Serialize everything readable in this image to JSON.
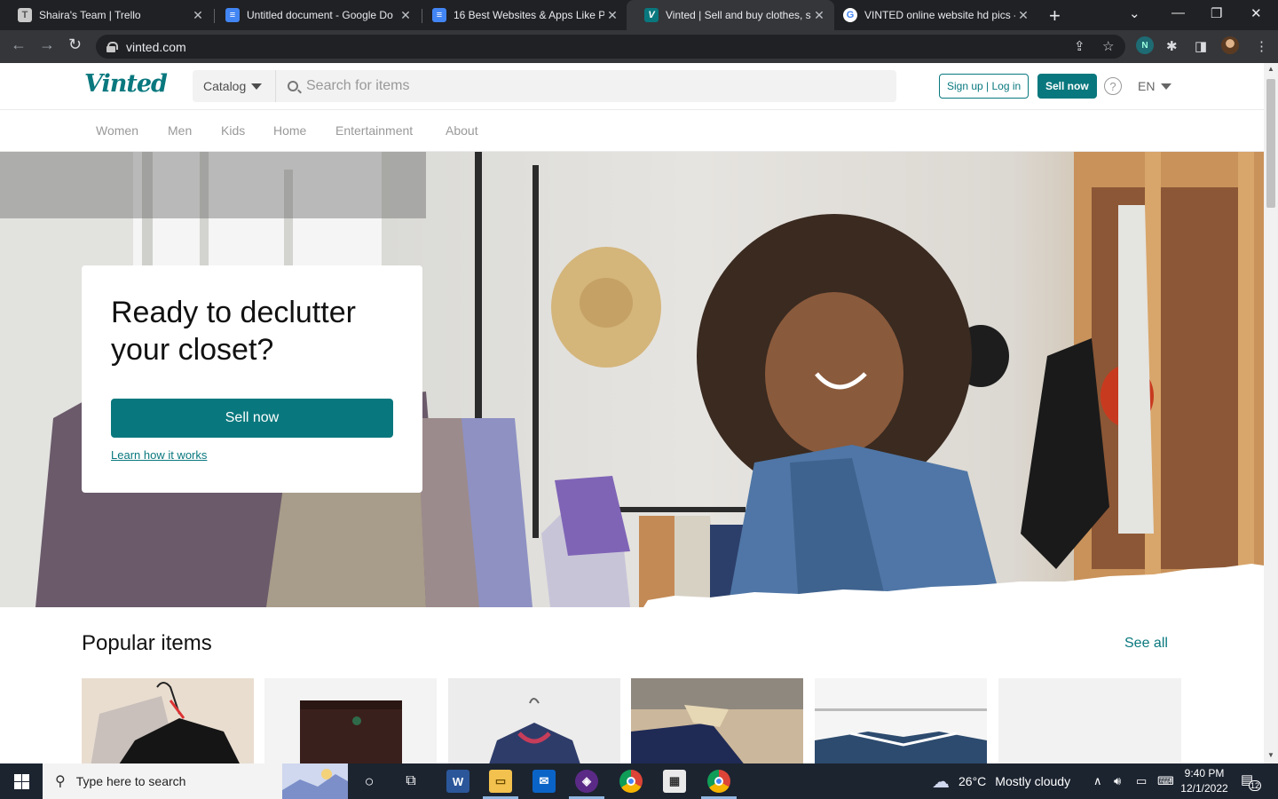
{
  "browser": {
    "tabs": [
      {
        "title": "Shaira's Team | Trello",
        "icon": "trello-icon",
        "color": "#c9c9c9",
        "glyph": "T"
      },
      {
        "title": "Untitled document - Google Do",
        "icon": "google-docs-icon",
        "color": "#4285f4",
        "glyph": "≡"
      },
      {
        "title": "16 Best Websites & Apps Like P",
        "icon": "google-docs-icon",
        "color": "#4285f4",
        "glyph": "≡"
      },
      {
        "title": "Vinted | Sell and buy clothes, sh",
        "icon": "vinted-icon",
        "color": "#09787e",
        "glyph": "V"
      },
      {
        "title": "VINTED online website hd pics -",
        "icon": "google-icon",
        "color": "#ffffff",
        "glyph": "G"
      }
    ],
    "url": "vinted.com"
  },
  "vinted": {
    "logo": "Vinted",
    "catalog_label": "Catalog",
    "search_placeholder": "Search for items",
    "login_label": "Sign up | Log in",
    "sell_header_label": "Sell now",
    "help_glyph": "?",
    "language": "EN",
    "nav": [
      "Women",
      "Men",
      "Kids",
      "Home",
      "Entertainment",
      "About"
    ],
    "hero": {
      "title": "Ready to declutter your closet?",
      "sell_button": "Sell now",
      "learn_link": "Learn how it works"
    },
    "popular": {
      "title": "Popular items",
      "see_all": "See all"
    },
    "accent_color": "#09787e"
  },
  "taskbar": {
    "search_placeholder": "Type here to search",
    "weather_temp": "26°C",
    "weather_text": "Mostly cloudy",
    "time": "9:40 PM",
    "date": "12/1/2022",
    "notifications": "12"
  }
}
